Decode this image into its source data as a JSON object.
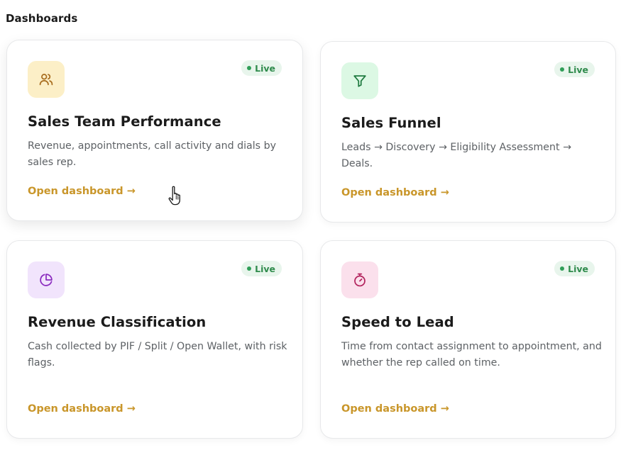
{
  "section": {
    "title": "Dashboards"
  },
  "colors": {
    "accent_link": "#c9962a",
    "live_badge_bg": "#e8f5ec",
    "live_badge_text": "#2f8b4c"
  },
  "cards": [
    {
      "title": "Sales Team Performance",
      "description": "Revenue, appointments, call activity and dials by sales rep.",
      "badge": "Live",
      "link": "Open dashboard →",
      "icon": "users-icon",
      "icon_bg": "#fcefc7",
      "icon_color": "#a86d1e"
    },
    {
      "title": "Sales Funnel",
      "description": "Leads → Discovery → Eligibility Assessment → Deals.",
      "badge": "Live",
      "link": "Open dashboard →",
      "icon": "funnel-icon",
      "icon_bg": "#dcf8e4",
      "icon_color": "#1f7a40"
    },
    {
      "title": "Revenue Classification",
      "description": "Cash collected by PIF / Split / Open Wallet, with risk flags.",
      "badge": "Live",
      "link": "Open dashboard →",
      "icon": "pie-chart-icon",
      "icon_bg": "#f1e4fc",
      "icon_color": "#8a2bbf"
    },
    {
      "title": "Speed to Lead",
      "description": "Time from contact assignment to appointment, and whether the rep called on time.",
      "badge": "Live",
      "link": "Open dashboard →",
      "icon": "timer-icon",
      "icon_bg": "#fbe0ec",
      "icon_color": "#b3245e"
    }
  ]
}
